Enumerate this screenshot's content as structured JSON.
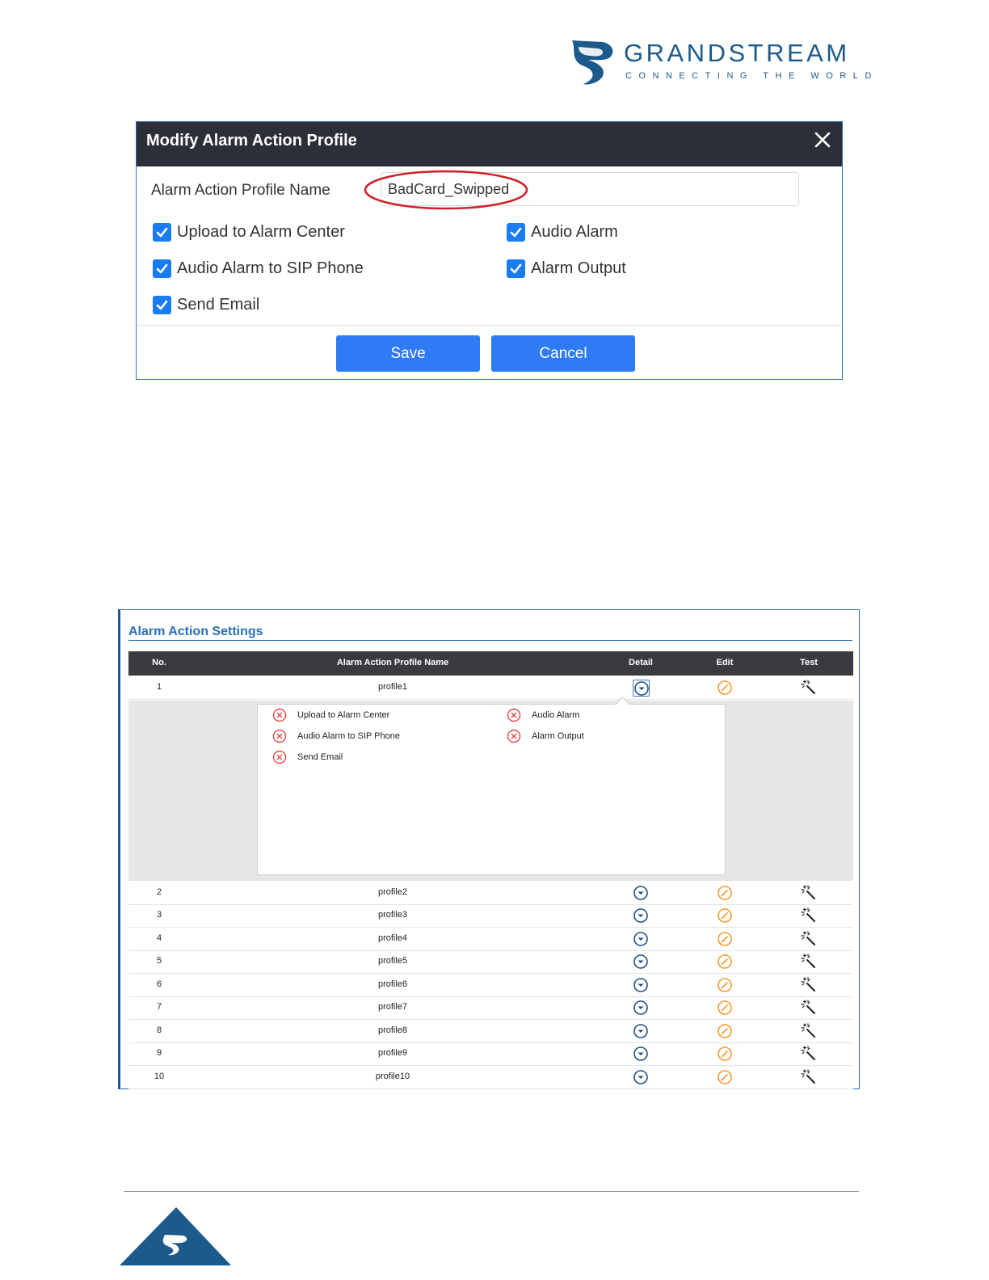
{
  "brand": {
    "name": "GRANDSTREAM",
    "tagline": "CONNECTING THE WORLD",
    "color": "#1c5a8c"
  },
  "modal": {
    "title": "Modify Alarm Action Profile",
    "close_icon": "close-icon",
    "profile_name_label": "Alarm Action Profile Name",
    "profile_name_value": "BadCard_Swipped",
    "options": [
      {
        "label": "Upload to Alarm Center",
        "checked": true
      },
      {
        "label": "Audio Alarm",
        "checked": true
      },
      {
        "label": "Audio Alarm to SIP Phone",
        "checked": true
      },
      {
        "label": "Alarm Output",
        "checked": true
      },
      {
        "label": "Send Email",
        "checked": true
      }
    ],
    "save_label": "Save",
    "cancel_label": "Cancel",
    "accent_color": "#2f7bf6",
    "highlight_color": "#d0202a"
  },
  "settings": {
    "title": "Alarm Action Settings",
    "columns": [
      "No.",
      "Alarm Action Profile Name",
      "Detail",
      "Edit",
      "Test"
    ],
    "rows": [
      {
        "no": "1",
        "name": "profile1"
      },
      {
        "no": "2",
        "name": "profile2"
      },
      {
        "no": "3",
        "name": "profile3"
      },
      {
        "no": "4",
        "name": "profile4"
      },
      {
        "no": "5",
        "name": "profile5"
      },
      {
        "no": "6",
        "name": "profile6"
      },
      {
        "no": "7",
        "name": "profile7"
      },
      {
        "no": "8",
        "name": "profile8"
      },
      {
        "no": "9",
        "name": "profile9"
      },
      {
        "no": "10",
        "name": "profile10"
      }
    ],
    "detail_items": [
      {
        "label": "Upload to Alarm Center",
        "enabled": false
      },
      {
        "label": "Audio Alarm",
        "enabled": false
      },
      {
        "label": "Audio Alarm to SIP Phone",
        "enabled": false
      },
      {
        "label": "Alarm Output",
        "enabled": false
      },
      {
        "label": "Send Email",
        "enabled": false
      }
    ],
    "icons": {
      "detail": "chevron-down-circle-icon",
      "edit": "edit-circle-icon",
      "test": "magic-wand-icon",
      "disabled": "x-circle-icon"
    },
    "colors": {
      "header": "#3a3b3f",
      "title": "#2a6fb8",
      "edit": "#f29a2e",
      "detail": "#1f4f82",
      "disabled": "#e04848"
    }
  }
}
